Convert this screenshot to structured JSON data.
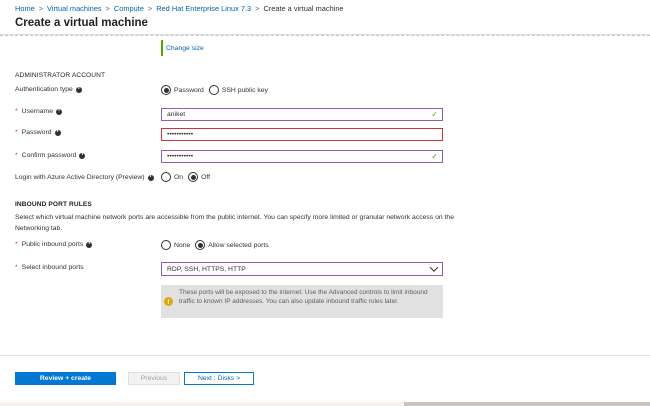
{
  "breadcrumb": {
    "items": [
      "Home",
      "Virtual machines",
      "Compute",
      "Red Hat Enterprise Linux 7.3"
    ],
    "current": "Create a virtual machine",
    "separator": ">"
  },
  "page_title": "Create a virtual machine",
  "change_size_link": "Change size",
  "admin_account": {
    "heading": "ADMINISTRATOR ACCOUNT",
    "auth_type": {
      "label": "Authentication type",
      "options": [
        "Password",
        "SSH public key"
      ],
      "selected": "Password"
    },
    "username": {
      "label": "Username",
      "value": "aniket"
    },
    "password": {
      "label": "Password",
      "value": "•••••••••••"
    },
    "confirm_password": {
      "label": "Confirm password",
      "value": "•••••••••••"
    },
    "aad_login": {
      "label": "Login with Azure Active Directory (Preview)",
      "options": [
        "On",
        "Off"
      ],
      "selected": "Off"
    }
  },
  "inbound_rules": {
    "heading": "INBOUND PORT RULES",
    "description": "Select which virtual machine network ports are accessible from the public internet. You can specify more limited or granular network access on the Networking tab.",
    "public_ports": {
      "label": "Public inbound ports",
      "options": [
        "None",
        "Allow selected ports"
      ],
      "selected": "Allow selected ports"
    },
    "select_ports": {
      "label": "Select inbound ports",
      "value": "RDP, SSH, HTTPS, HTTP"
    },
    "warning": "These ports will be exposed to the internet. Use the Advanced controls to limit inbound traffic to known IP addresses. You can also update inbound traffic rules later."
  },
  "footer": {
    "review_create": "Review + create",
    "previous": "Previous",
    "next": "Next : Disks >"
  },
  "colors": {
    "accent": "#0078d4",
    "link": "#0063b1",
    "error_border": "#d13438",
    "field_border": "#8a5fb5",
    "valid_check": "#57a300",
    "warning_icon": "#e0a800"
  },
  "icons": {
    "info": "info-icon",
    "valid": "check-icon",
    "dropdown": "chevron-down-icon",
    "warning": "warning-icon"
  }
}
